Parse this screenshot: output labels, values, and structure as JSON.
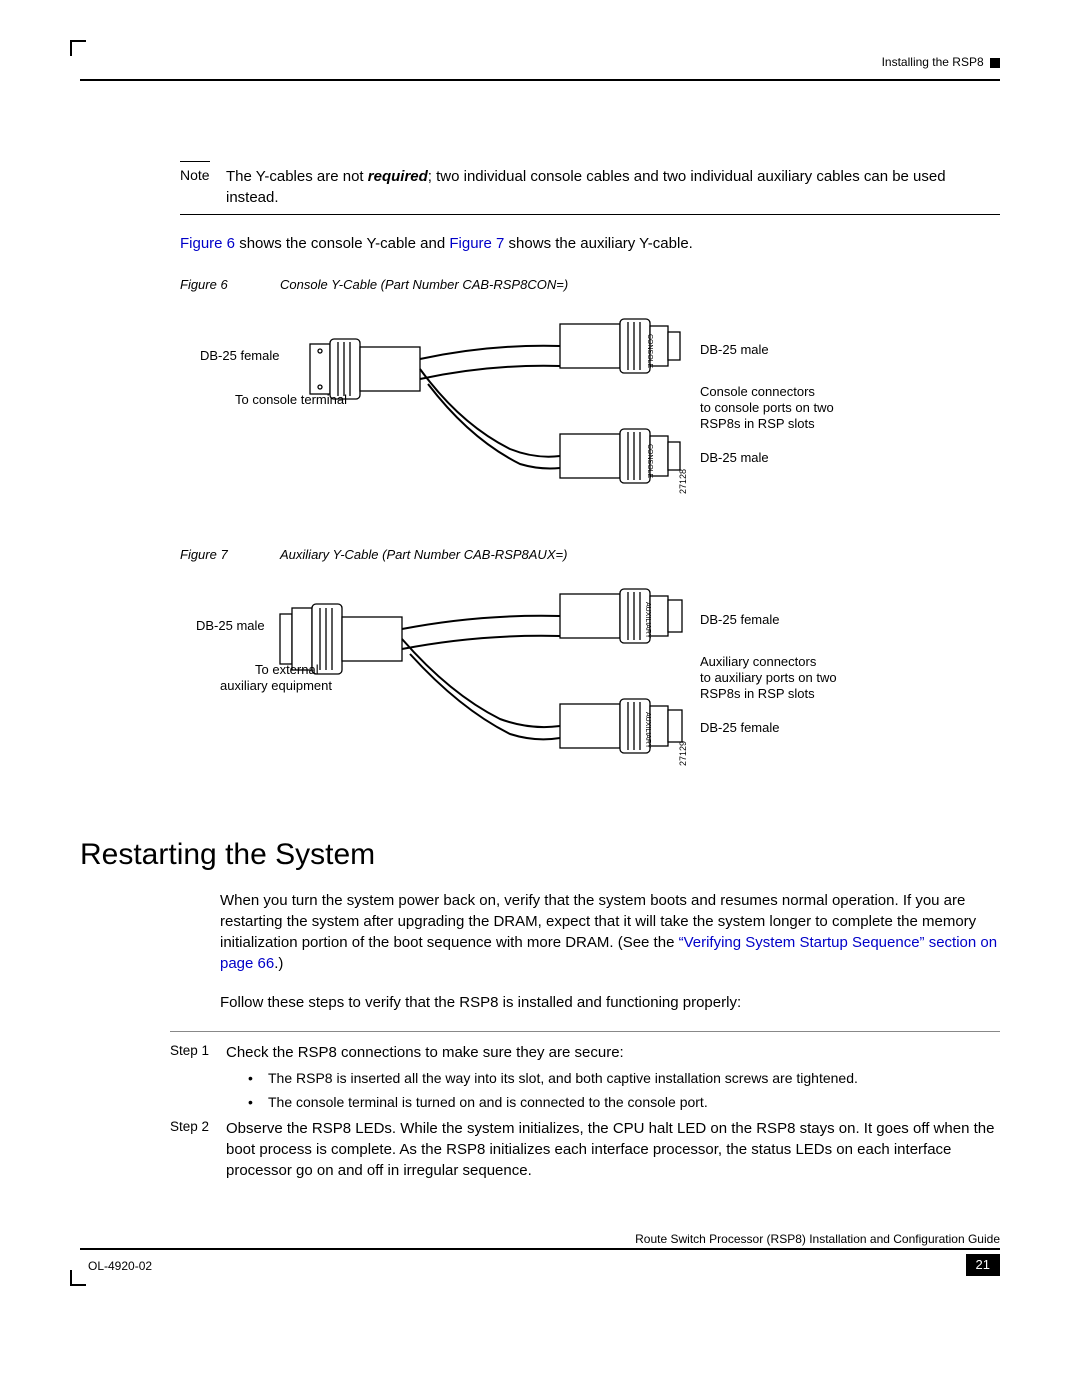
{
  "header": {
    "right": "Installing the RSP8"
  },
  "note": {
    "label": "Note",
    "text_pre": "The Y-cables are not ",
    "required": "required",
    "text_post": "; two individual console cables and two individual auxiliary cables can be used instead."
  },
  "intro": {
    "f6_link": "Figure 6",
    "f6_txt": " shows the console Y-cable and ",
    "f7_link": "Figure 7",
    "f7_txt": " shows the auxiliary Y-cable."
  },
  "fig6": {
    "num": "Figure 6",
    "title": "Console Y-Cable (Part Number CAB-RSP8CON=)",
    "left_conn": "DB-25 female",
    "left_sub": "To console terminal",
    "port_label": "CONSOLE",
    "top_conn": "DB-25 male",
    "mid1": "Console connectors",
    "mid2": "to console ports on two",
    "mid3": "RSP8s in RSP slots",
    "bot_conn": "DB-25 male",
    "drawing_no": "27128"
  },
  "fig7": {
    "num": "Figure 7",
    "title": "Auxiliary Y-Cable (Part Number CAB-RSP8AUX=)",
    "left_conn": "DB-25 male",
    "left_sub1": "To external",
    "left_sub2": "auxiliary equipment",
    "port_label": "AUXILIARY",
    "top_conn": "DB-25 female",
    "mid1": "Auxiliary connectors",
    "mid2": "to auxiliary ports on two",
    "mid3": "RSP8s in RSP slots",
    "bot_conn": "DB-25 female",
    "drawing_no": "27129"
  },
  "section": {
    "heading": "Restarting the System",
    "p1a": "When you turn the system power back on, verify that the system boots and resumes normal operation. If you are restarting the system after upgrading the DRAM, expect that it will take the system longer to complete the memory initialization portion of the boot sequence with more DRAM. (See the ",
    "p1_link": "“Verifying System Startup Sequence” section on page 66",
    "p1b": ".)",
    "p2": "Follow these steps to verify that the RSP8 is installed and functioning properly:",
    "step1_label": "Step 1",
    "step1_text": "Check the RSP8 connections to make sure they are secure:",
    "step1_b1": "The RSP8 is inserted all the way into its slot, and both captive installation screws are tightened.",
    "step1_b2": "The console terminal is turned on and is connected to the console port.",
    "step2_label": "Step 2",
    "step2_text": "Observe the RSP8 LEDs. While the system initializes, the CPU halt LED on the RSP8 stays on. It goes off when the boot process is complete. As the RSP8 initializes each interface processor, the status LEDs on each interface processor go on and off in irregular sequence."
  },
  "footer": {
    "guide": "Route Switch Processor (RSP8) Installation and Configuration Guide",
    "doc_no": "OL-4920-02",
    "page": "21"
  }
}
